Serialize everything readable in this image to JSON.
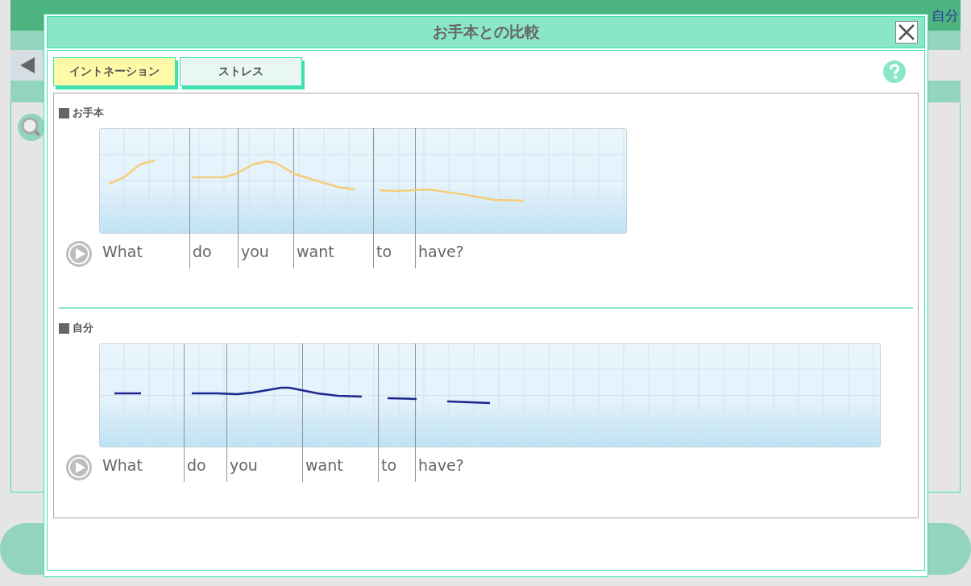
{
  "background": {
    "user_label": "自分"
  },
  "dialog": {
    "title": "お手本との比較",
    "tabs": [
      {
        "label": "イントネーション",
        "selected": true
      },
      {
        "label": "ストレス",
        "selected": false
      }
    ],
    "sections": [
      {
        "label": "お手本",
        "kind": "model",
        "words": [
          "What",
          "do",
          "you",
          "want",
          "to",
          "have?"
        ]
      },
      {
        "label": "自分",
        "kind": "user",
        "words": [
          "What",
          "do",
          "you",
          "want",
          "to",
          "have?"
        ]
      }
    ]
  }
}
